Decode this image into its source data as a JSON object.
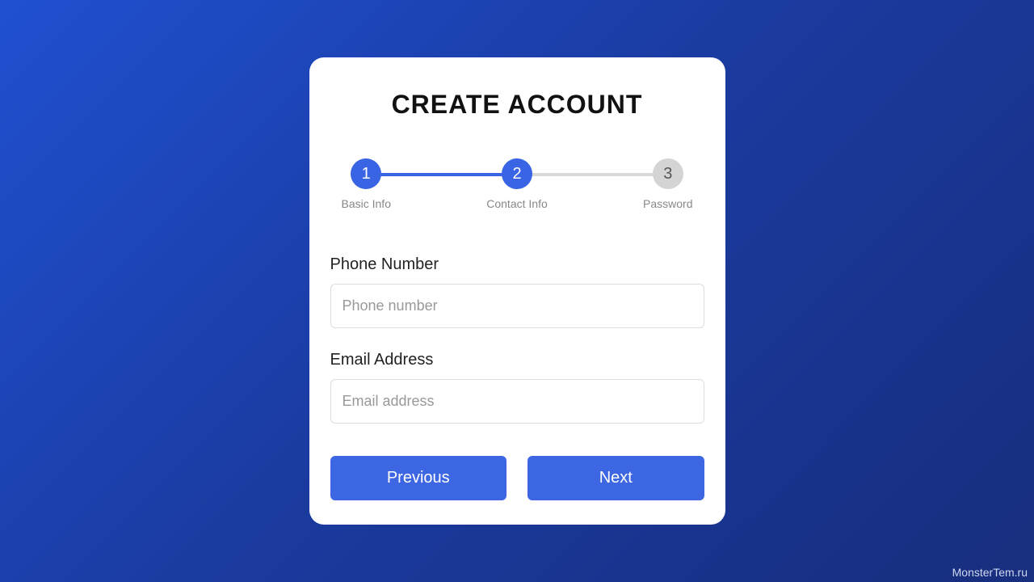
{
  "title": "CREATE ACCOUNT",
  "steps": [
    {
      "number": "1",
      "label": "Basic Info",
      "state": "active"
    },
    {
      "number": "2",
      "label": "Contact Info",
      "state": "active"
    },
    {
      "number": "3",
      "label": "Password",
      "state": "inactive"
    }
  ],
  "form": {
    "phone": {
      "label": "Phone Number",
      "placeholder": "Phone number"
    },
    "email": {
      "label": "Email Address",
      "placeholder": "Email address"
    }
  },
  "buttons": {
    "previous": "Previous",
    "next": "Next"
  },
  "watermark": "MonsterTem.ru"
}
